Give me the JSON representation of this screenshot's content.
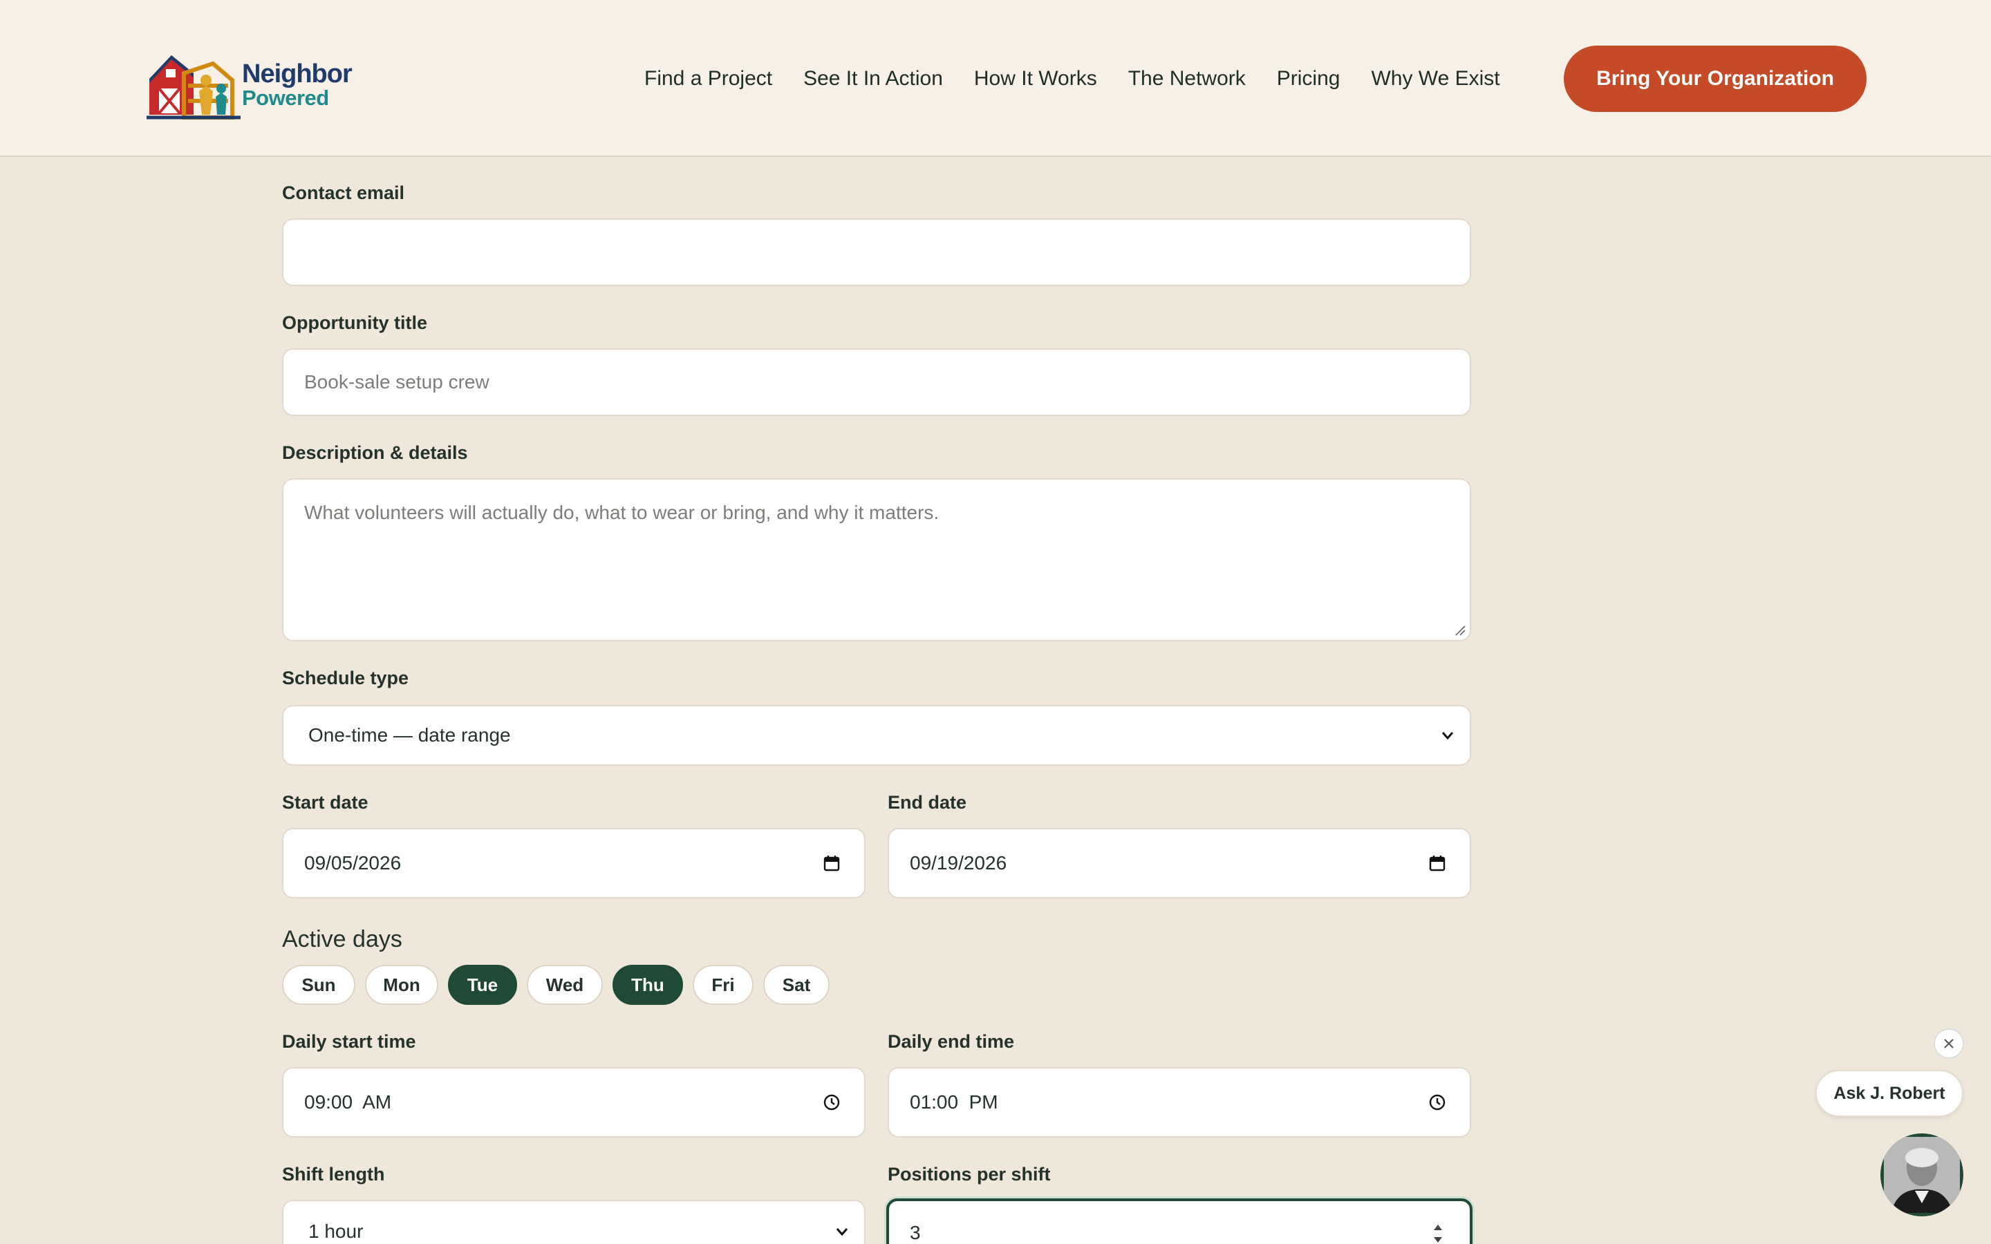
{
  "brand": {
    "name_line1": "Neighbor",
    "name_line2": "Powered"
  },
  "nav": {
    "items": [
      "Find a Project",
      "See It In Action",
      "How It Works",
      "The Network",
      "Pricing",
      "Why We Exist"
    ],
    "cta": "Bring Your Organization"
  },
  "form": {
    "contact_email": {
      "label": "Contact email",
      "value": ""
    },
    "opportunity_title": {
      "label": "Opportunity title",
      "placeholder": "Book-sale setup crew"
    },
    "description": {
      "label": "Description & details",
      "placeholder": "What volunteers will actually do, what to wear or bring, and why it matters."
    },
    "schedule_type": {
      "label": "Schedule type",
      "value": "One-time — date range"
    },
    "start_date": {
      "label": "Start date",
      "value": "09/05/2026"
    },
    "end_date": {
      "label": "End date",
      "value": "09/19/2026"
    },
    "active_days": {
      "label": "Active days",
      "days": [
        {
          "label": "Sun",
          "selected": false
        },
        {
          "label": "Mon",
          "selected": false
        },
        {
          "label": "Tue",
          "selected": true
        },
        {
          "label": "Wed",
          "selected": false
        },
        {
          "label": "Thu",
          "selected": true
        },
        {
          "label": "Fri",
          "selected": false
        },
        {
          "label": "Sat",
          "selected": false
        }
      ]
    },
    "daily_start_time": {
      "label": "Daily start time",
      "value": "09:00  AM"
    },
    "daily_end_time": {
      "label": "Daily end time",
      "value": "01:00  PM"
    },
    "shift_length": {
      "label": "Shift length",
      "value": "1 hour"
    },
    "positions_per_shift": {
      "label": "Positions per shift",
      "value": "3"
    }
  },
  "assistant": {
    "label": "Ask J. Robert"
  },
  "colors": {
    "accent": "#c44a28",
    "primary": "#1f4a35",
    "background": "#efe7da"
  }
}
